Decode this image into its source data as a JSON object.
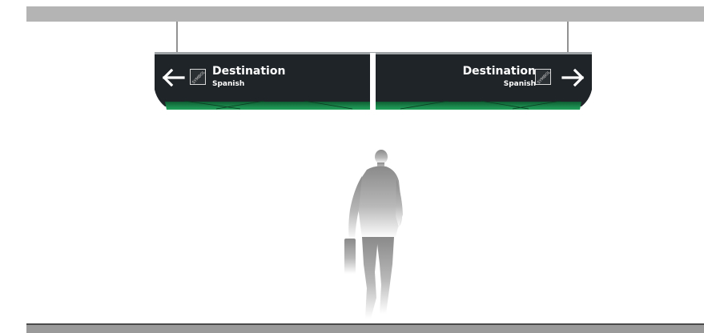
{
  "signs": [
    {
      "title": "Destination",
      "subtitle": "Spanish",
      "symbol": "SYMBOL",
      "arrow": "arrow-left-icon"
    },
    {
      "title": "Destination",
      "subtitle": "Spanish",
      "symbol": "SYMBOL",
      "arrow": "arrow-right-icon"
    }
  ],
  "colors": {
    "sign_panel": "#1f2428",
    "sign_glow": "#1b8a4a",
    "beam": "#b4b4b4",
    "floor": "#9a9a9a",
    "figure": "#8e8e8e"
  }
}
